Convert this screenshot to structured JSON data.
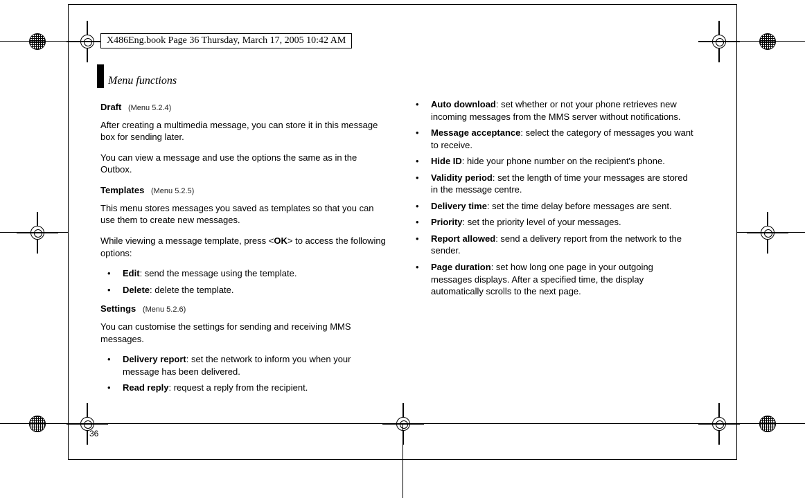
{
  "header": "X486Eng.book  Page 36  Thursday, March 17, 2005  10:42 AM",
  "section_title": "Menu functions",
  "page_number": "36",
  "left": {
    "draft": {
      "title": "Draft",
      "ref": "(Menu 5.2.4)",
      "p1": "After creating a multimedia message, you can store it in this message box for sending later.",
      "p2": "You can view a message and use the options the same as in the Outbox."
    },
    "templates": {
      "title": "Templates",
      "ref": "(Menu 5.2.5)",
      "p1": "This menu stores messages you saved as templates so that you can use them to create new messages.",
      "p2a": "While viewing a message template, press <",
      "ok": "OK",
      "p2b": "> to access the following options:",
      "items": [
        {
          "name": "Edit",
          "desc": ": send the message using the template."
        },
        {
          "name": "Delete",
          "desc": ": delete the template."
        }
      ]
    },
    "settings": {
      "title": "Settings",
      "ref": "(Menu 5.2.6)",
      "p1": "You can customise the settings for sending and receiving MMS messages.",
      "items": [
        {
          "name": "Delivery report",
          "desc": ": set the network to inform you when your message has been delivered."
        },
        {
          "name": "Read reply",
          "desc": ": request a reply from the recipient."
        }
      ]
    }
  },
  "right": {
    "items": [
      {
        "name": "Auto download",
        "desc": ": set whether or not your phone retrieves new incoming messages from the MMS server without notifications."
      },
      {
        "name": "Message acceptance",
        "desc": ": select the category of messages you want to receive."
      },
      {
        "name": "Hide ID",
        "desc": ": hide your phone number on the recipient's phone."
      },
      {
        "name": "Validity period",
        "desc": ": set the length of time your messages are stored in the message centre."
      },
      {
        "name": "Delivery time",
        "desc": ": set the time delay before messages are sent."
      },
      {
        "name": "Priority",
        "desc": ": set the priority level of your messages."
      },
      {
        "name": "Report allowed",
        "desc": ": send a delivery report from the network to the sender."
      },
      {
        "name": "Page duration",
        "desc": ": set how long one page in your outgoing messages displays. After a specified time, the display automatically scrolls to the next page."
      }
    ]
  }
}
